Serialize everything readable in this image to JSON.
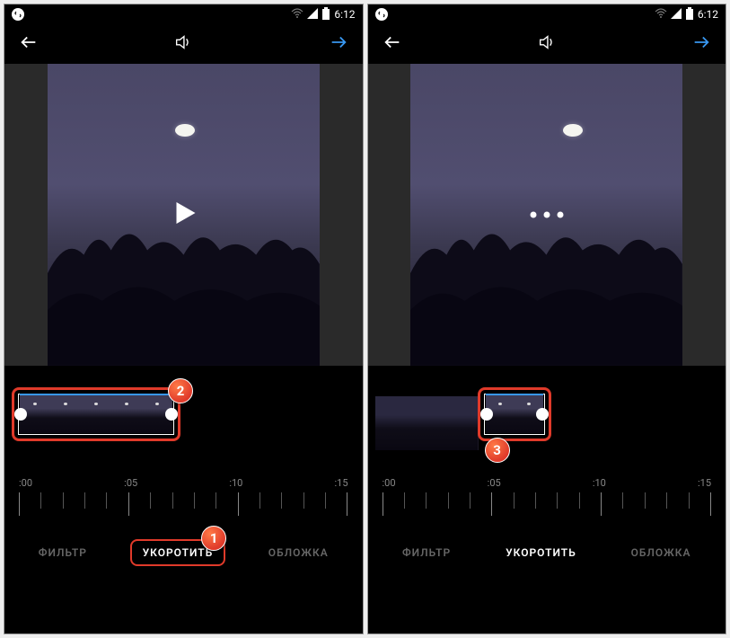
{
  "status": {
    "time": "6:12"
  },
  "tabs": {
    "filter": "ФИЛЬТР",
    "trim": "УКОРОТИТЬ",
    "cover": "ОБЛОЖКА"
  },
  "ruler": {
    "t0": ":00",
    "t5": ":05",
    "t10": ":10",
    "t15": ":15"
  },
  "badges": {
    "one": "1",
    "two": "2",
    "three": "3"
  }
}
